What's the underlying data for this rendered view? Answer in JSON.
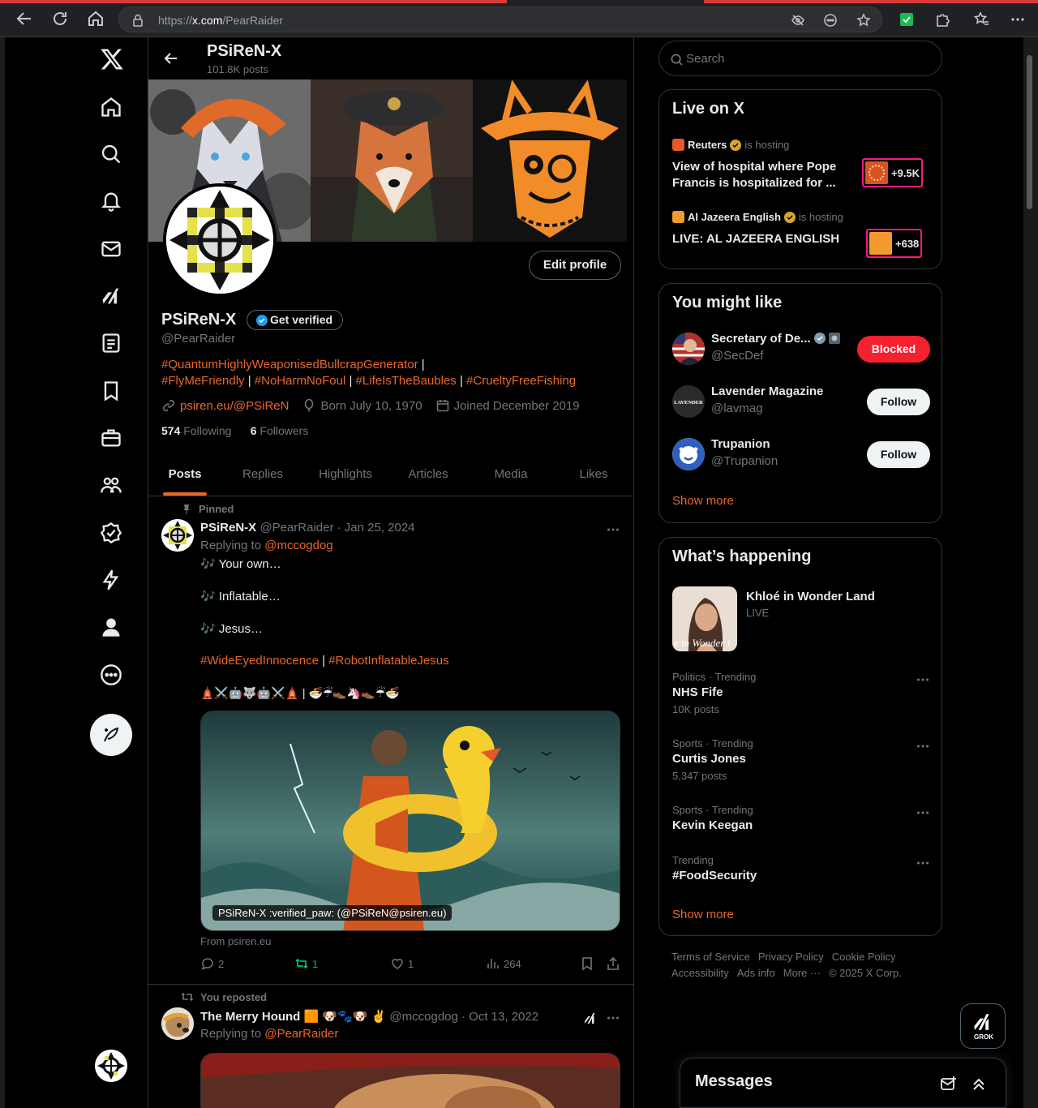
{
  "browser": {
    "url_prefix": "https://",
    "url_host": "x.com",
    "url_path": "/PearRaider"
  },
  "profile": {
    "header_name": "PSiReN-X",
    "post_count": "101.8K posts",
    "display_name": "PSiReN-X",
    "get_verified_label": "Get verified",
    "handle": "@PearRaider",
    "edit_profile_label": "Edit profile",
    "bio_line1_tag": "#QuantumHighlyWeaponisedBullcrapGenerator",
    "bio_sep": " | ",
    "bio_tag2": "#FlyMeFriendly",
    "bio_tag3": "#NoHarmNoFoul",
    "bio_tag4": "#LifeIsTheBaubles",
    "bio_tag5": "#CrueltyFreeFishing",
    "link": "psiren.eu/@PSiReN",
    "birthday": "Born July 10, 1970",
    "joined": "Joined December 2019",
    "following_count": "574",
    "following_label": "Following",
    "followers_count": "6",
    "followers_label": "Followers"
  },
  "tabs": [
    "Posts",
    "Replies",
    "Highlights",
    "Articles",
    "Media",
    "Likes"
  ],
  "pinned_post": {
    "pinned_label": "Pinned",
    "author": "PSiReN-X",
    "handle_date": "@PearRaider · Jan 25, 2024",
    "replying_prefix": "Replying to ",
    "replying_to": "@mccogdog",
    "line1": "🎶 Your own…",
    "line2": "🎶 Inflatable…",
    "line3": "🎶 Jesus…",
    "tag1": "#WideEyedInnocence",
    "tag_sep": " | ",
    "tag2": "#RobotInflatableJesus",
    "emoji_line": "🛕⚔️🤖🐺🤖⚔️🛕 | 🍜☔👞🦄👞☔🍜",
    "image_caption": "PSiReN-X :verified_paw: (@PSiReN@psiren.eu)",
    "source": "From psiren.eu",
    "replies": "2",
    "reposts": "1",
    "likes": "1",
    "views": "264"
  },
  "repost": {
    "label": "You reposted",
    "author": "The Merry Hound 🟧 🐶🐾🐶 ✌️",
    "handle_date": "@mccogdog · Oct 13, 2022",
    "replying_prefix": "Replying to ",
    "replying_to": "@PearRaider"
  },
  "search": {
    "placeholder": "Search"
  },
  "live": {
    "title": "Live on X",
    "items": [
      {
        "host": "Reuters",
        "is_hosting": "is hosting",
        "title": "View of hospital where Pope Francis is hospitalized for ...",
        "count": "+9.5K",
        "color": "#e8572a"
      },
      {
        "host": "Al Jazeera English",
        "is_hosting": "is hosting",
        "title": "LIVE: AL JAZEERA ENGLISH",
        "count": "+638",
        "color": "#f29a2e"
      }
    ]
  },
  "suggestions": {
    "title": "You might like",
    "items": [
      {
        "name": "Secretary of De...",
        "handle": "@SecDef",
        "button": "Blocked"
      },
      {
        "name": "Lavender Magazine",
        "handle": "@lavmag",
        "button": "Follow",
        "avatar_text": "LAVENDER"
      },
      {
        "name": "Trupanion",
        "handle": "@Trupanion",
        "button": "Follow"
      }
    ],
    "show_more": "Show more"
  },
  "happening": {
    "title": "What’s happening",
    "featured": {
      "title": "Khloé in Wonder Land",
      "sub": "LIVE",
      "thumb_text": "e in Wonder l"
    },
    "trends": [
      {
        "category": "Politics · Trending",
        "title": "NHS Fife",
        "count": "10K posts"
      },
      {
        "category": "Sports · Trending",
        "title": "Curtis Jones",
        "count": "5,347 posts"
      },
      {
        "category": "Sports · Trending",
        "title": "Kevin Keegan",
        "count": ""
      },
      {
        "category": "Trending",
        "title": "#FoodSecurity",
        "count": ""
      }
    ],
    "show_more": "Show more"
  },
  "footer": {
    "links": [
      "Terms of Service",
      "Privacy Policy",
      "Cookie Policy",
      "Accessibility",
      "Ads info",
      "More ···",
      "© 2025 X Corp."
    ]
  },
  "grok": {
    "label": "GROK"
  },
  "messages": {
    "title": "Messages"
  },
  "colors": {
    "accent": "#e8672a",
    "blocked": "#f4212e",
    "live_border": "#f91880"
  }
}
